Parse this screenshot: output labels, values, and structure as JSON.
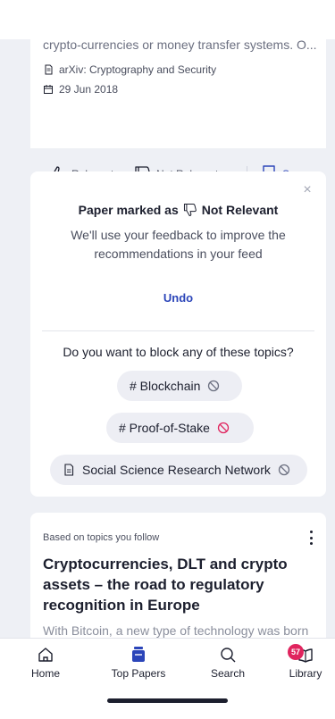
{
  "feed": {
    "card1": {
      "abstract": "crypto-currencies or money transfer systems. O...",
      "source": "arXiv: Cryptography and Security",
      "date": "29 Jun 2018",
      "actions": {
        "relevant": "Relevant",
        "not_relevant": "Not Relevant",
        "save": "Save"
      }
    },
    "feedback": {
      "marked_prefix": "Paper marked as",
      "marked_value": "Not Relevant",
      "message": "We'll use your feedback to improve the recommendations in your feed",
      "undo": "Undo",
      "block_question": "Do you want to block any of these topics?",
      "topics": [
        "# Blockchain",
        "# Proof-of-Stake",
        "Social Science Research Network"
      ]
    },
    "card3": {
      "note": "Based on topics you follow",
      "title": "Cryptocurrencies, DLT and crypto assets – the road to regulatory recognition in Europe",
      "abstract": "With Bitcoin, a new type of technology was born"
    }
  },
  "tabbar": {
    "home": "Home",
    "top_papers": "Top Papers",
    "search": "Search",
    "library": "Library",
    "library_badge": "57"
  },
  "colors": {
    "accent": "#2b45b9",
    "badge": "#e0245e",
    "blocked": "#e0245e"
  }
}
